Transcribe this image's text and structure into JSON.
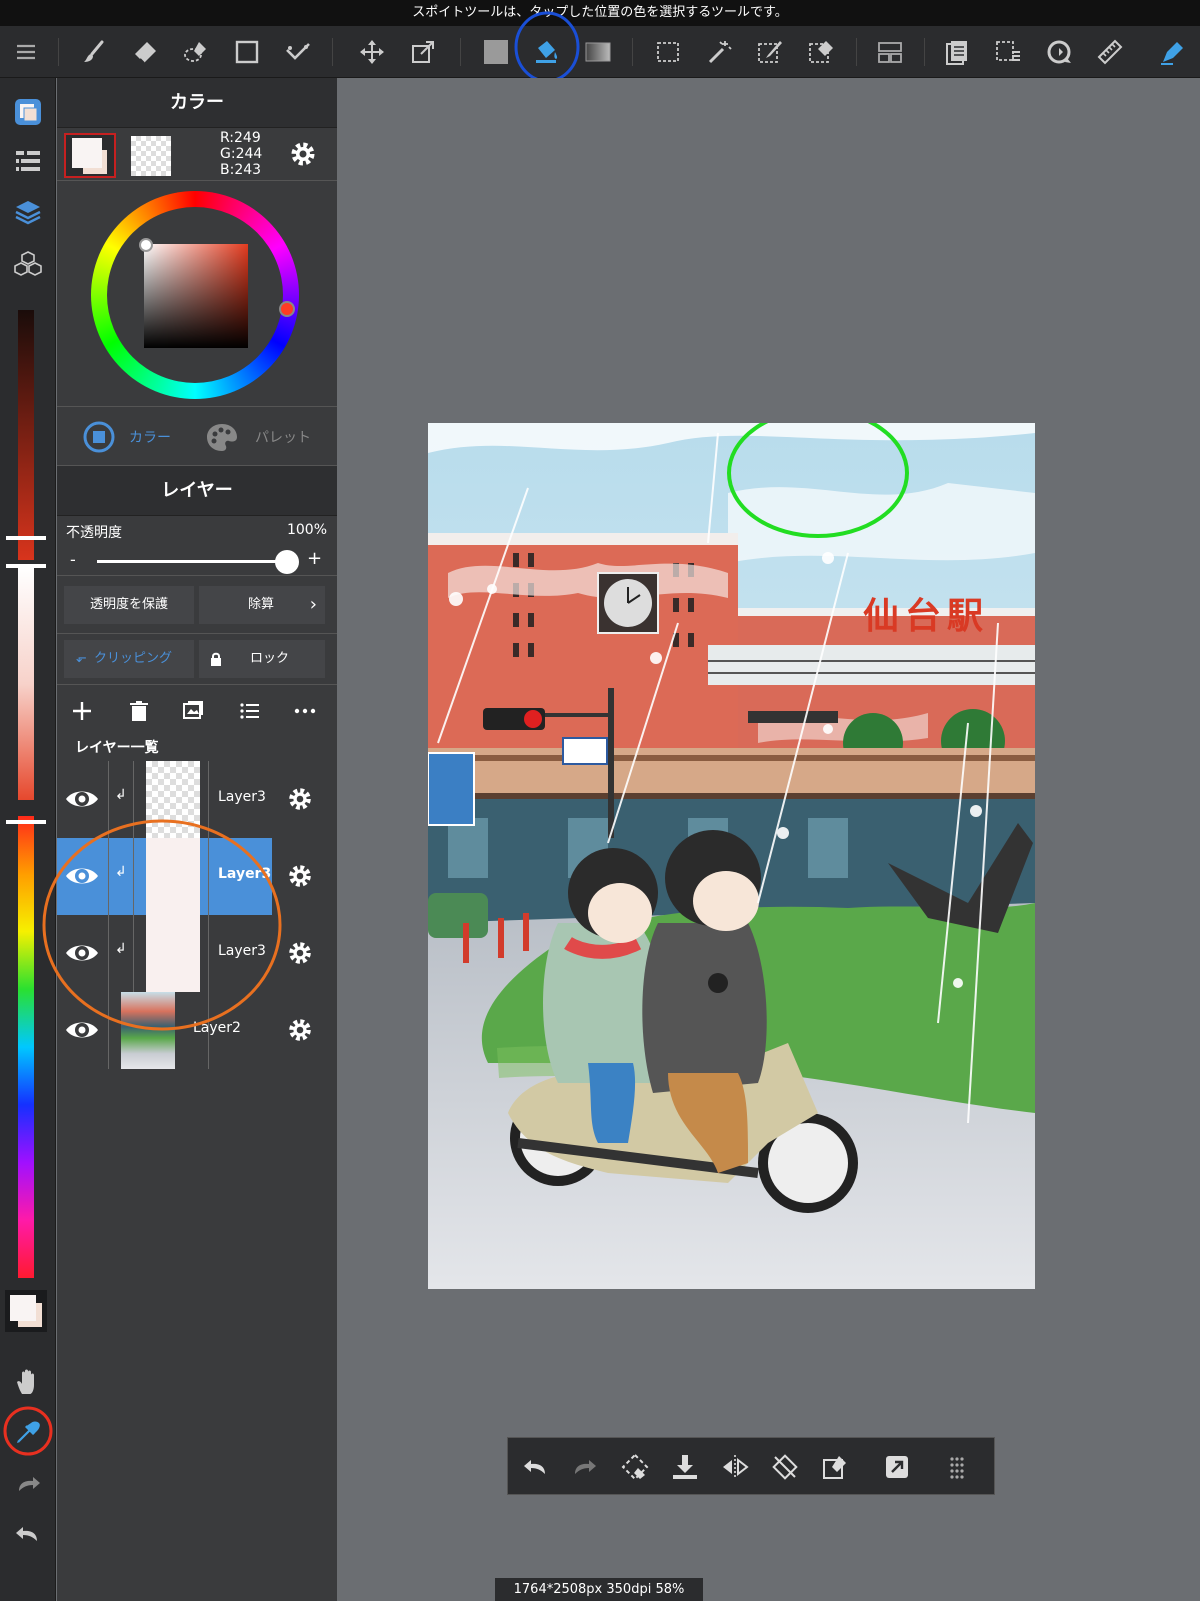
{
  "top_message": "スポイトツールは、タップした位置の色を選択するツールです。",
  "toolbar": {
    "icons": [
      "menu-icon",
      "brush-icon",
      "eraser-icon",
      "lasso-eraser-icon",
      "rectangle-icon",
      "select-pen-icon",
      "move-icon",
      "transform-icon",
      "fill-color-icon",
      "bucket-icon",
      "gradient-icon",
      "select-rect-icon",
      "magic-wand-icon",
      "select-pen2-icon",
      "select-eraser-icon",
      "frame-icon",
      "layers-copy-icon",
      "select-list-icon",
      "rotate-icon",
      "ruler-icon",
      "settings-pen-icon"
    ]
  },
  "color_panel": {
    "title": "カラー",
    "rgb": {
      "r": "R:249",
      "g": "G:244",
      "b": "B:243"
    },
    "main_color": "#f9f4f3",
    "tabs": [
      {
        "label": "カラー",
        "active": true
      },
      {
        "label": "パレット",
        "active": false
      }
    ]
  },
  "layer_panel": {
    "title": "レイヤー",
    "opacity_label": "不透明度",
    "opacity_value": "100%",
    "opacity_fraction": 1.0,
    "minus": "-",
    "plus": "+",
    "protect_alpha": "透明度を保護",
    "blend_mode": "除算",
    "clipping": "クリッピング",
    "lock": "ロック",
    "list_title": "レイヤー一覧",
    "layers": [
      {
        "name": "Layer3",
        "selected": false,
        "thumb": "transparent"
      },
      {
        "name": "Layer3",
        "selected": true,
        "thumb": "solid"
      },
      {
        "name": "Layer3",
        "selected": false,
        "thumb": "solid"
      },
      {
        "name": "Layer2",
        "selected": false,
        "thumb": "image"
      }
    ]
  },
  "canvas": {
    "status": "1764*2508px 350dpi 58%",
    "artwork_text": "仙台駅"
  },
  "colors": {
    "accent_blue": "#4a90d9",
    "annotation_blue": "#1a4fd6",
    "annotation_green": "#22dd22",
    "annotation_orange": "#e87020",
    "annotation_red": "#e83020"
  }
}
